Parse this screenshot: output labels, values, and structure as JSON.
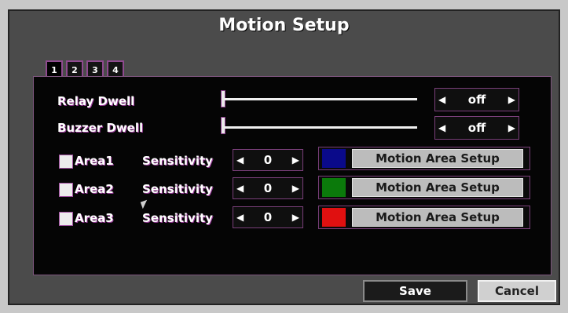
{
  "dialog": {
    "title": "Motion Setup"
  },
  "tabs": [
    "1",
    "2",
    "3",
    "4"
  ],
  "relay_dwell": {
    "label": "Relay Dwell",
    "value": "off"
  },
  "buzzer_dwell": {
    "label": "Buzzer Dwell",
    "value": "off"
  },
  "areas": [
    {
      "label": "Area1",
      "sensitivity_label": "Sensitivity",
      "sensitivity": "0",
      "setup_label": "Motion Area Setup",
      "color": "#0a0a8a"
    },
    {
      "label": "Area2",
      "sensitivity_label": "Sensitivity",
      "sensitivity": "0",
      "setup_label": "Motion Area Setup",
      "color": "#0b7a0b"
    },
    {
      "label": "Area3",
      "sensitivity_label": "Sensitivity",
      "sensitivity": "0",
      "setup_label": "Motion Area Setup",
      "color": "#e01010"
    }
  ],
  "buttons": {
    "save": "Save",
    "cancel": "Cancel"
  }
}
